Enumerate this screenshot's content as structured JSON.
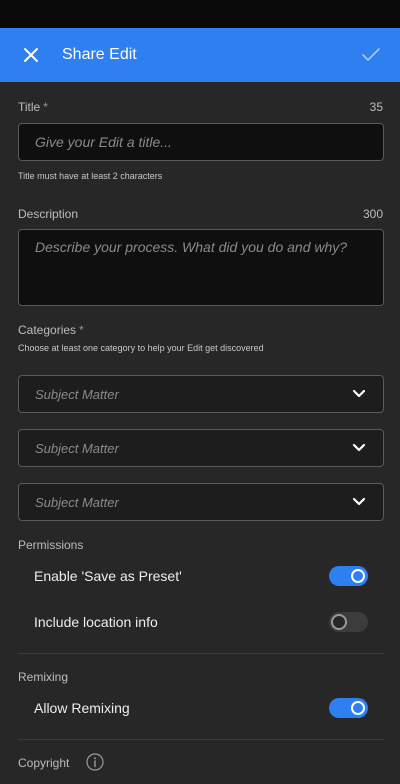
{
  "header": {
    "title": "Share Edit",
    "close_icon": "close-icon",
    "confirm_icon": "check-icon"
  },
  "title_field": {
    "label": "Title",
    "required_mark": "*",
    "counter": "35",
    "placeholder": "Give your Edit a title...",
    "value": "",
    "hint": "Title must have at least 2 characters"
  },
  "description_field": {
    "label": "Description",
    "counter": "300",
    "placeholder": "Describe your process. What did you do and why?",
    "value": ""
  },
  "categories": {
    "label": "Categories",
    "required_mark": "*",
    "hint": "Choose at least one category to help your Edit get discovered",
    "dropdowns": [
      {
        "placeholder": "Subject Matter"
      },
      {
        "placeholder": "Subject Matter"
      },
      {
        "placeholder": "Subject Matter"
      }
    ]
  },
  "permissions": {
    "label": "Permissions",
    "items": [
      {
        "label": "Enable 'Save as Preset'",
        "enabled": true
      },
      {
        "label": "Include location info",
        "enabled": false
      }
    ]
  },
  "remixing": {
    "label": "Remixing",
    "items": [
      {
        "label": "Allow Remixing",
        "enabled": true
      }
    ]
  },
  "copyright": {
    "label": "Copyright",
    "info_icon": "info-icon"
  },
  "colors": {
    "accent": "#2e7ff0",
    "background": "#272727",
    "field_background": "#0f0f0f"
  }
}
